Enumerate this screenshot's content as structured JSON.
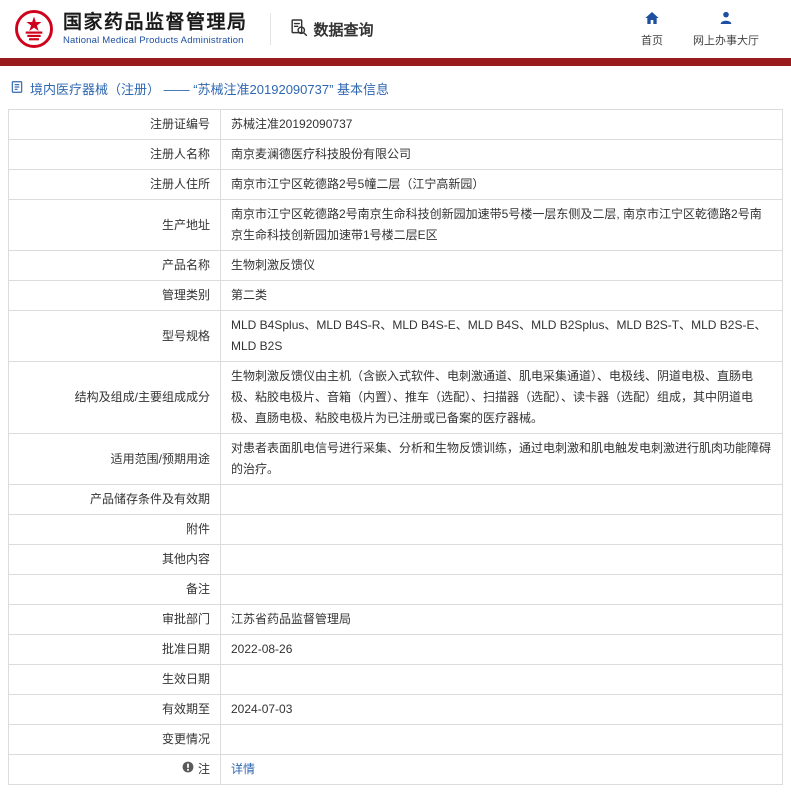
{
  "header": {
    "agency_cn": "国家药品监督管理局",
    "agency_en": "National Medical Products Administration",
    "section_label": "数据查询",
    "nav_home": "首页",
    "nav_hall": "网上办事大厅"
  },
  "colors": {
    "accent_red": "#9A1B1E",
    "emblem_red": "#D0021B",
    "link_blue": "#2E67B1",
    "nav_icon_blue": "#1E4FA0"
  },
  "breadcrumb": "境内医疗器械（注册） —— “苏械注准20192090737” 基本信息",
  "table": {
    "rows": [
      {
        "label": "注册证编号",
        "value": "苏械注准20192090737"
      },
      {
        "label": "注册人名称",
        "value": "南京麦澜德医疗科技股份有限公司"
      },
      {
        "label": "注册人住所",
        "value": "南京市江宁区乾德路2号5幢二层（江宁高新园）"
      },
      {
        "label": "生产地址",
        "value": "南京市江宁区乾德路2号南京生命科技创新园加速带5号楼一层东侧及二层, 南京市江宁区乾德路2号南京生命科技创新园加速带1号楼二层E区"
      },
      {
        "label": "产品名称",
        "value": "生物刺激反馈仪"
      },
      {
        "label": "管理类别",
        "value": "第二类"
      },
      {
        "label": "型号规格",
        "value": "MLD B4Splus、MLD B4S-R、MLD B4S-E、MLD B4S、MLD B2Splus、MLD B2S-T、MLD B2S-E、MLD B2S"
      },
      {
        "label": "结构及组成/主要组成成分",
        "value": "生物刺激反馈仪由主机（含嵌入式软件、电刺激通道、肌电采集通道）、电极线、阴道电极、直肠电极、粘胶电极片、音箱（内置）、推车（选配）、扫描器（选配）、读卡器（选配）组成，其中阴道电极、直肠电极、粘胶电极片为已注册或已备案的医疗器械。"
      },
      {
        "label": "适用范围/预期用途",
        "value": "对患者表面肌电信号进行采集、分析和生物反馈训练，通过电刺激和肌电触发电刺激进行肌肉功能障碍的治疗。"
      },
      {
        "label": "产品储存条件及有效期",
        "value": ""
      },
      {
        "label": "附件",
        "value": ""
      },
      {
        "label": "其他内容",
        "value": ""
      },
      {
        "label": "备注",
        "value": ""
      },
      {
        "label": "审批部门",
        "value": "江苏省药品监督管理局"
      },
      {
        "label": "批准日期",
        "value": "2022-08-26"
      },
      {
        "label": "生效日期",
        "value": ""
      },
      {
        "label": "有效期至",
        "value": "2024-07-03"
      },
      {
        "label": "变更情况",
        "value": ""
      }
    ],
    "note_label": "注",
    "note_link": "详情"
  }
}
